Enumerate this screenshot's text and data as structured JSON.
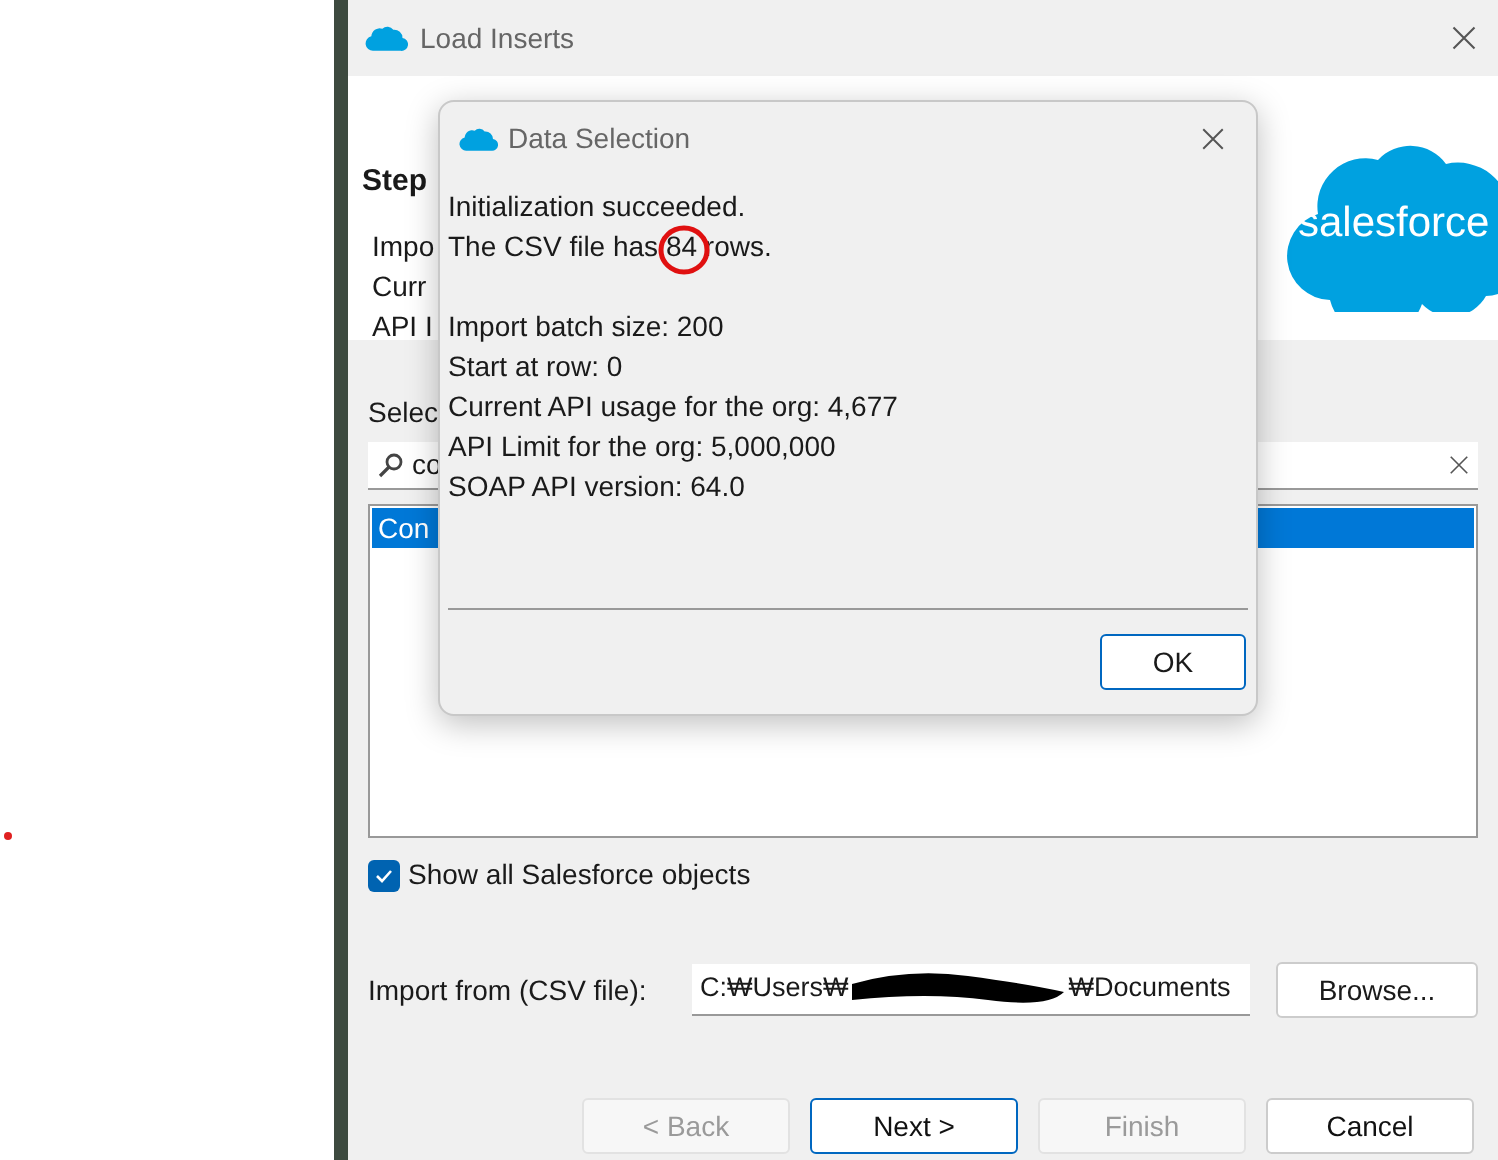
{
  "window": {
    "title": "Load Inserts"
  },
  "header": {
    "step": "Step",
    "lines": [
      "Impo",
      "Curr",
      "API I"
    ],
    "logo": "salesforce"
  },
  "select_label": "Selec",
  "search": {
    "value": "co"
  },
  "objects": [
    {
      "label": "Con",
      "selected": true
    }
  ],
  "show_all": {
    "label": "Show all Salesforce objects",
    "checked": true
  },
  "import_from": {
    "label": "Import from (CSV file):",
    "value_start": "C:₩Users₩",
    "value_end": "₩Documents"
  },
  "browse": "Browse...",
  "buttons": [
    {
      "label": "< Back",
      "disabled": true,
      "default": false
    },
    {
      "label": "Next >",
      "disabled": false,
      "default": true
    },
    {
      "label": "Finish",
      "disabled": true,
      "default": false
    },
    {
      "label": "Cancel",
      "disabled": false,
      "default": false
    }
  ],
  "dialog": {
    "title": "Data Selection",
    "lines": [
      {
        "kind": "text",
        "before": "Initialization succeeded."
      },
      {
        "kind": "text",
        "before": "The CSV file has ",
        "circled": "84",
        "after": " rows."
      },
      {
        "kind": "blank"
      },
      {
        "kind": "text",
        "before": "Import batch size: 200"
      },
      {
        "kind": "text",
        "before": "Start at row: 0"
      },
      {
        "kind": "text",
        "before": "Current API usage for the org: 4,677"
      },
      {
        "kind": "text",
        "before": "API Limit for the org: 5,000,000"
      },
      {
        "kind": "text",
        "before": "SOAP API version: 64.0"
      }
    ],
    "ok": "OK"
  }
}
